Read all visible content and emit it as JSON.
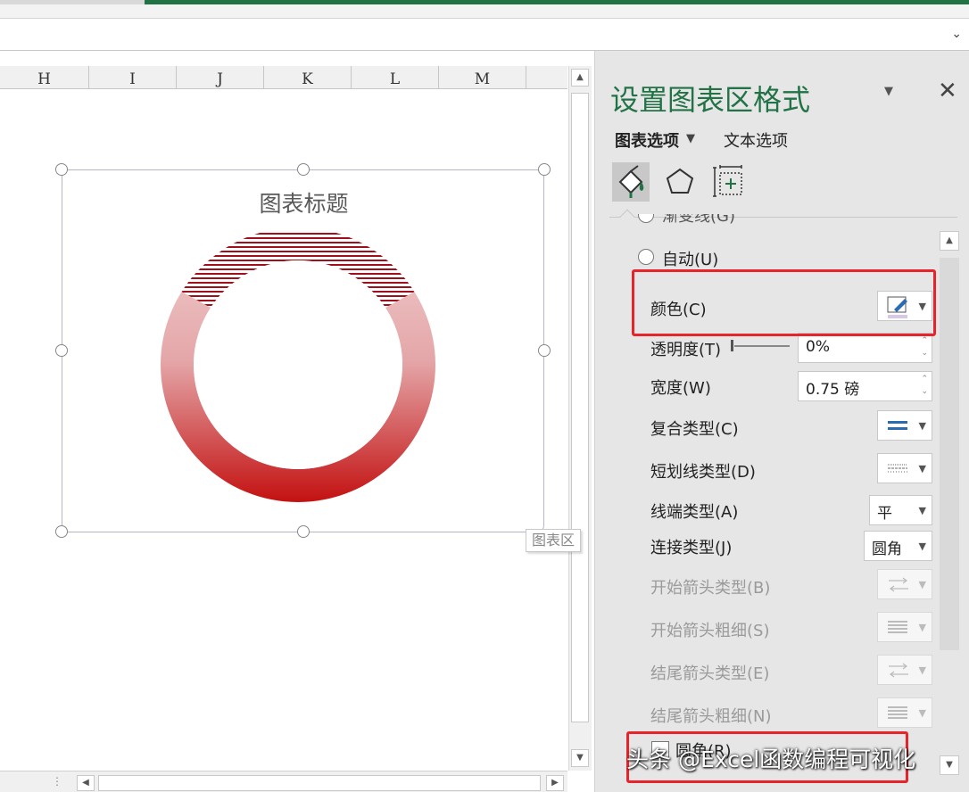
{
  "columns": [
    "H",
    "I",
    "J",
    "K",
    "L",
    "M"
  ],
  "chart": {
    "title": "图表标题",
    "area_tag": "图表区",
    "colors": {
      "ring_top": "#e8b4b6",
      "ring_bottom": "#c00000",
      "hatch": "#a0101c"
    }
  },
  "pane": {
    "title": "设置图表区格式",
    "tabs": {
      "chart_options": "图表选项",
      "text_options": "文本选项"
    },
    "icons": [
      "fill-line-icon",
      "effects-pentagon-icon",
      "size-properties-icon"
    ],
    "cut_off_option": "渐变线(G)",
    "auto_option": "自动(U)",
    "rows": {
      "color": {
        "label": "颜色(C)"
      },
      "transparency": {
        "label": "透明度(T)",
        "value": "0%"
      },
      "width": {
        "label": "宽度(W)",
        "value": "0.75 磅"
      },
      "compound_type": {
        "label": "复合类型(C)"
      },
      "dash_type": {
        "label": "短划线类型(D)"
      },
      "cap_type": {
        "label": "线端类型(A)",
        "value": "平"
      },
      "join_type": {
        "label": "连接类型(J)",
        "value": "圆角"
      },
      "begin_arrow_type": {
        "label": "开始箭头类型(B)"
      },
      "begin_arrow_size": {
        "label": "开始箭头粗细(S)"
      },
      "end_arrow_type": {
        "label": "结尾箭头类型(E)"
      },
      "end_arrow_size": {
        "label": "结尾箭头粗细(N)"
      },
      "rounded_corners": {
        "label": "圆角(R)"
      }
    }
  },
  "watermark": "头条 @Excel函数编程可视化",
  "accent": "#217346",
  "highlight": "#e8242a"
}
